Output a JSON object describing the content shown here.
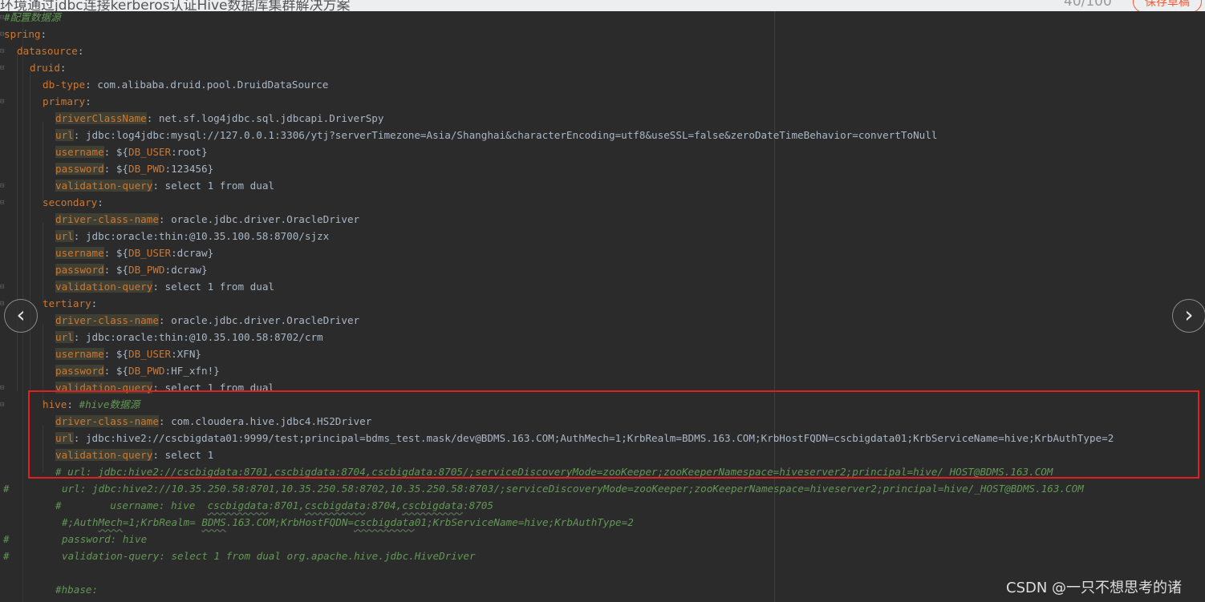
{
  "page_header": {
    "article_title": "环境通过jdbc连接kerberos认证Hive数据库集群解决方案",
    "word_count": "40/100",
    "save_draft_label": "保存草稿"
  },
  "editor": {
    "lines": [
      {
        "text": "#配置数据源"
      },
      {
        "key": "spring",
        "sep": ":"
      },
      {
        "key": "datasource",
        "sep": ":"
      },
      {
        "key": "druid",
        "sep": ":"
      },
      {
        "key": "db-type",
        "sep": ": ",
        "value": "com.alibaba.druid.pool.DruidDataSource"
      },
      {
        "key": "primary",
        "sep": ":"
      },
      {
        "key": "driverClassName",
        "sep": ": ",
        "value": "net.sf.log4jdbc.sql.jdbcapi.DriverSpy"
      },
      {
        "key": "url",
        "sep": ": ",
        "value": "jdbc:log4jdbc:mysql://127.0.0.1:3306/ytj?serverTimezone=Asia/Shanghai&characterEncoding=utf8&useSSL=false&zeroDateTimeBehavior=convertToNull"
      },
      {
        "key": "username",
        "sep": ": ",
        "pre": "${",
        "var": "DB_USER",
        "post": ":root}"
      },
      {
        "key": "password",
        "sep": ": ",
        "pre": "${",
        "var": "DB_PWD",
        "post": ":123456}"
      },
      {
        "key": "validation-query",
        "sep": ": ",
        "value": "select 1 from dual"
      },
      {
        "key": "secondary",
        "sep": ":"
      },
      {
        "key": "driver-class-name",
        "sep": ": ",
        "value": "oracle.jdbc.driver.OracleDriver"
      },
      {
        "key": "url",
        "sep": ": ",
        "value": "jdbc:oracle:thin:@10.35.100.58:8700/sjzx"
      },
      {
        "key": "username",
        "sep": ": ",
        "pre": "${",
        "var": "DB_USER",
        "post": ":dcraw}"
      },
      {
        "key": "password",
        "sep": ": ",
        "pre": "${",
        "var": "DB_PWD",
        "post": ":dcraw}"
      },
      {
        "key": "validation-query",
        "sep": ": ",
        "value": "select 1 from dual"
      },
      {
        "key": "tertiary",
        "sep": ":"
      },
      {
        "key": "driver-class-name",
        "sep": ": ",
        "value": "oracle.jdbc.driver.OracleDriver"
      },
      {
        "key": "url",
        "sep": ": ",
        "value": "jdbc:oracle:thin:@10.35.100.58:8702/crm"
      },
      {
        "key": "username",
        "sep": ": ",
        "pre": "${",
        "var": "DB_USER",
        "post": ":XFN}"
      },
      {
        "key": "password",
        "sep": ": ",
        "pre": "${",
        "var": "DB_PWD",
        "post": ":HF_xfn!}"
      },
      {
        "key": "validation-query",
        "sep": ": ",
        "value": "select 1 from dual"
      },
      {
        "key": "hive",
        "sep": ": ",
        "comment": "#hive数据源"
      },
      {
        "key": "driver-class-name",
        "sep": ": ",
        "value": "com.cloudera.hive.jdbc4.HS2Driver"
      },
      {
        "key": "url",
        "sep": ": ",
        "value": "jdbc:hive2://cscbigdata01:9999/test;principal=bdms_test.mask/dev@BDMS.163.COM;AuthMech=1;KrbRealm=BDMS.163.COM;KrbHostFQDN=cscbigdata01;KrbServiceName=hive;KrbAuthType=2"
      },
      {
        "key": "validation-query",
        "sep": ": ",
        "value": "select 1"
      },
      {
        "comment": "# url: jdbc:hive2://cscbigdata:8701,cscbigdata:8704,cscbigdata:8705/;serviceDiscoveryMode=zooKeeper;zooKeeperNamespace=hiveserver2;principal=hive/_HOST@BDMS.163.COM"
      },
      {
        "hash": "#",
        "comment": "url: jdbc:hive2://10.35.250.58:8701,10.35.250.58:8702,10.35.250.58:8703/;serviceDiscoveryMode=zooKeeper;zooKeeperNamespace=hiveserver2;principal=hive/_HOST@BDMS.163.COM"
      },
      {
        "comment": "#        username: hive  cscbigdata:8701,cscbigdata:8704,cscbigdata:8705"
      },
      {
        "comment": "#;AuthMech=1;KrbRealm= BDMS.163.COM;KrbHostFQDN=cscbigdata01;KrbServiceName=hive;KrbAuthType=2"
      },
      {
        "hash": "#",
        "comment": "password: hive"
      },
      {
        "hash": "#",
        "comment": "validation-query: select 1 from dual org.apache.hive.jdbc.HiveDriver"
      },
      {},
      {
        "comment": "#hbase:"
      }
    ]
  },
  "nav": {
    "prev_glyph": "‹",
    "next_glyph": "›"
  },
  "watermark": "CSDN @一只不想思考的诸"
}
